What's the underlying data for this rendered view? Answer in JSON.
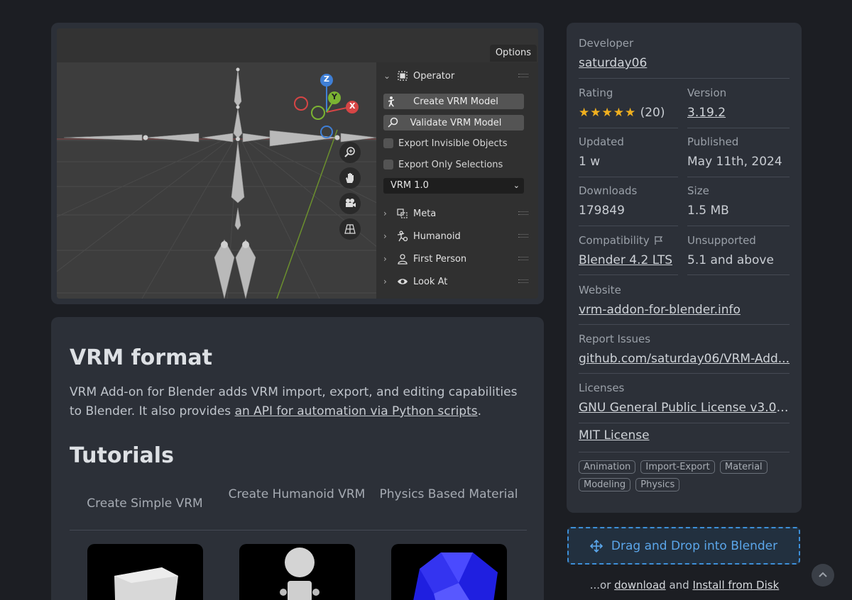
{
  "screenshot": {
    "options_label": "Options",
    "panel": {
      "operator_label": "Operator",
      "create_label": "Create VRM Model",
      "validate_label": "Validate VRM Model",
      "export_invisible_label": "Export Invisible Objects",
      "export_selections_label": "Export Only Selections",
      "vrm_version": "VRM 1.0",
      "sections": [
        "Meta",
        "Humanoid",
        "First Person",
        "Look At"
      ]
    },
    "gizmo": {
      "z": "Z",
      "y": "Y",
      "x": "X"
    }
  },
  "description": {
    "heading": "VRM format",
    "text_before": "VRM Add-on for Blender adds VRM import, export, and editing capabilities to Blender. It also provides ",
    "link_text": "an API for automation via Python scripts",
    "text_after": ".",
    "tutorials_heading": "Tutorials",
    "tutorials": [
      "Create Simple VRM",
      "Create Humanoid VRM",
      "Physics Based Material"
    ]
  },
  "info": {
    "developer_label": "Developer",
    "developer": "saturday06",
    "rating_label": "Rating",
    "rating_stars": 5,
    "rating_count": "(20)",
    "version_label": "Version",
    "version": "3.19.2",
    "updated_label": "Updated",
    "updated": "1 w",
    "published_label": "Published",
    "published": "May 11th, 2024",
    "downloads_label": "Downloads",
    "downloads": "179849",
    "size_label": "Size",
    "size": "1.5 MB",
    "compat_label": "Compatibility",
    "compat": "Blender 4.2 LTS",
    "unsupported_label": "Unsupported",
    "unsupported": "5.1 and above",
    "website_label": "Website",
    "website": "vrm-addon-for-blender.info",
    "issues_label": "Report Issues",
    "issues": "github.com/saturday06/VRM-Add...",
    "licenses_label": "Licenses",
    "license_1": "GNU General Public License v3.0 o...",
    "license_2": "MIT License",
    "tags": [
      "Animation",
      "Import-Export",
      "Material",
      "Modeling",
      "Physics"
    ]
  },
  "actions": {
    "drag_label": "Drag and Drop into Blender",
    "or_prefix": "...or ",
    "download_label": "download",
    "and_text": " and ",
    "install_label": "Install from Disk"
  },
  "colors": {
    "accent": "#3d8fd8",
    "star": "#f0b01f",
    "card": "#2c3038",
    "page": "#1c1e23"
  }
}
